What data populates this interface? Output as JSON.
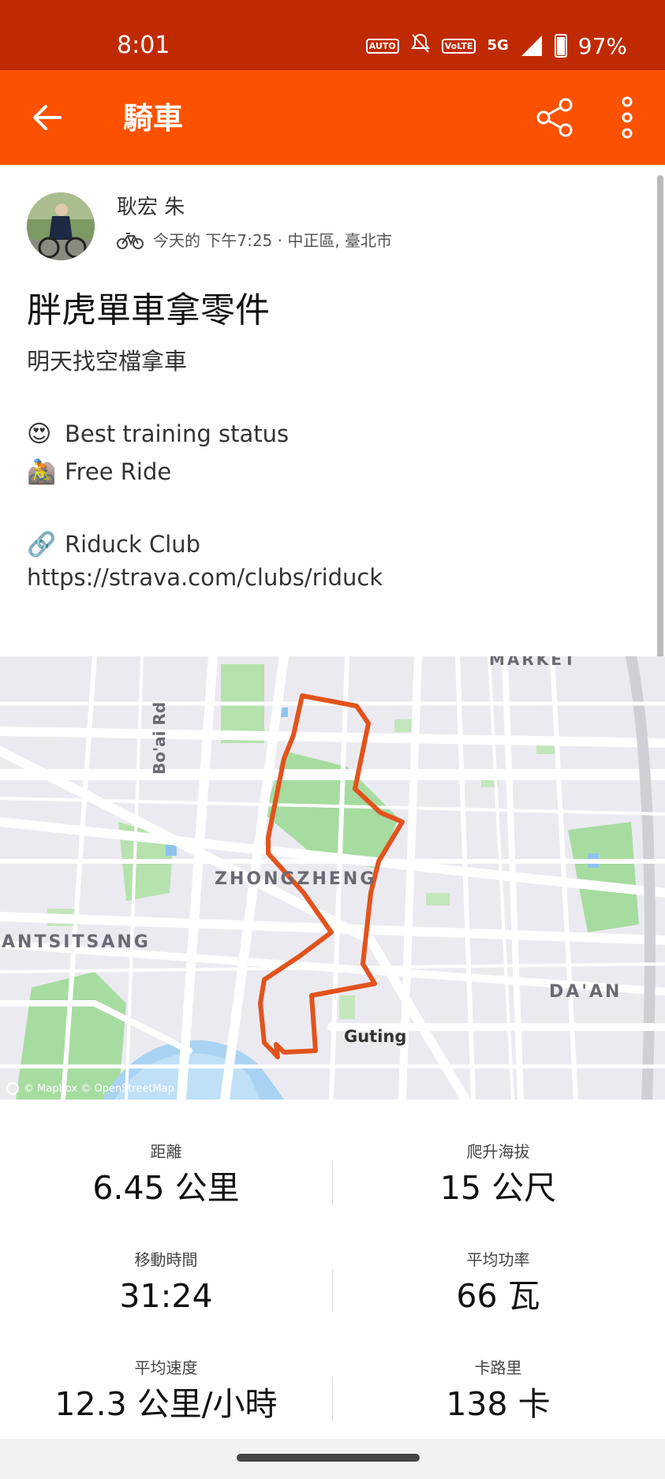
{
  "status_bar": {
    "time": "8:01",
    "network": "5G",
    "battery": "97%"
  },
  "header": {
    "title": "騎車"
  },
  "athlete": {
    "name": "耿宏 朱",
    "meta": "今天的 下午7:25 · 中正區, 臺北市"
  },
  "activity": {
    "title": "胖虎單車拿零件",
    "description_lines": [
      {
        "icon": "",
        "text": "明天找空檔拿車"
      },
      {
        "icon": "😍",
        "text": "Best training status"
      },
      {
        "icon": "🚵",
        "text": "Free Ride"
      },
      {
        "icon": "🔗",
        "text": "Riduck Club"
      },
      {
        "icon": "",
        "text": "https://strava.com/clubs/riduck"
      }
    ]
  },
  "map": {
    "labels": [
      "ZHONGZHENG",
      "ANTSITSANG",
      "DA'AN",
      "Guting",
      "Bo'ai Rd",
      "MARKET"
    ],
    "attribution": "© Mapbox © OpenStreetMap",
    "route_color": "#e2531d"
  },
  "stats": [
    {
      "label": "距離",
      "value": "6.45 公里"
    },
    {
      "label": "爬升海拔",
      "value": "15 公尺"
    },
    {
      "label": "移動時間",
      "value": "31:24"
    },
    {
      "label": "平均功率",
      "value": "66 瓦"
    },
    {
      "label": "平均速度",
      "value": "12.3 公里/小時"
    },
    {
      "label": "卡路里",
      "value": "138 卡"
    }
  ],
  "colors": {
    "status_bar": "#c02a00",
    "app_bar": "#fc5200",
    "route": "#e2531d"
  }
}
